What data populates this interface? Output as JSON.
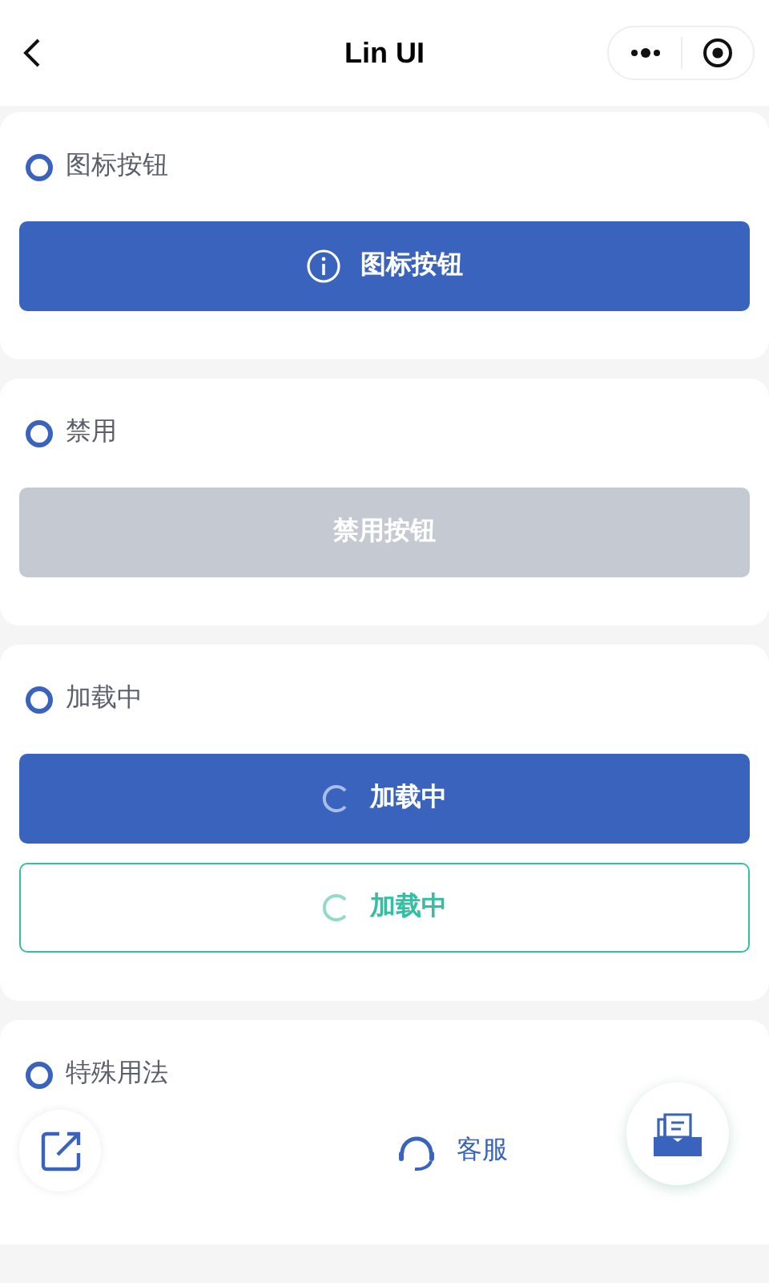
{
  "nav": {
    "title": "Lin UI"
  },
  "sections": [
    {
      "title": "图标按钮",
      "buttons": [
        {
          "label": "图标按钮",
          "kind": "icon",
          "outline": false,
          "disabled": false
        }
      ]
    },
    {
      "title": "禁用",
      "buttons": [
        {
          "label": "禁用按钮",
          "kind": "plain",
          "outline": false,
          "disabled": true
        }
      ]
    },
    {
      "title": "加载中",
      "buttons": [
        {
          "label": "加载中",
          "kind": "loading",
          "outline": false,
          "disabled": false
        },
        {
          "label": "加载中",
          "kind": "loading",
          "outline": true,
          "disabled": false
        }
      ]
    }
  ],
  "special": {
    "title": "特殊用法",
    "items": [
      {
        "kind": "share"
      },
      {
        "kind": "contact",
        "label": "客服"
      },
      {
        "kind": "float"
      }
    ]
  }
}
